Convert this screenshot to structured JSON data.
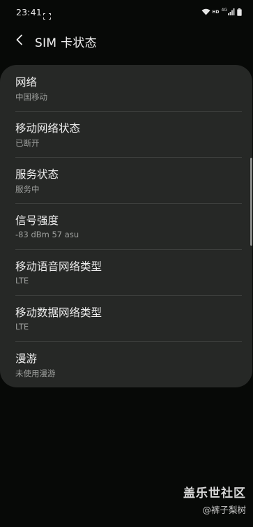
{
  "status_bar": {
    "time": "23:41",
    "icons": [
      "screenshot-icon",
      "wifi-icon",
      "hd-icon",
      "4g-signal-icon",
      "battery-icon"
    ],
    "hd_text": "HD",
    "network_text": "4G"
  },
  "header": {
    "back_icon": "chevron-left-icon",
    "title": "SIM 卡状态"
  },
  "items": [
    {
      "title": "网络",
      "value": "中国移动"
    },
    {
      "title": "移动网络状态",
      "value": "已断开"
    },
    {
      "title": "服务状态",
      "value": "服务中"
    },
    {
      "title": "信号强度",
      "value": "-83 dBm 57 asu"
    },
    {
      "title": "移动语音网络类型",
      "value": "LTE"
    },
    {
      "title": "移动数据网络类型",
      "value": "LTE"
    },
    {
      "title": "漫游",
      "value": "未使用漫游"
    }
  ],
  "watermark": {
    "brand": "盖乐世社区",
    "handle": "@裤子梨树"
  }
}
